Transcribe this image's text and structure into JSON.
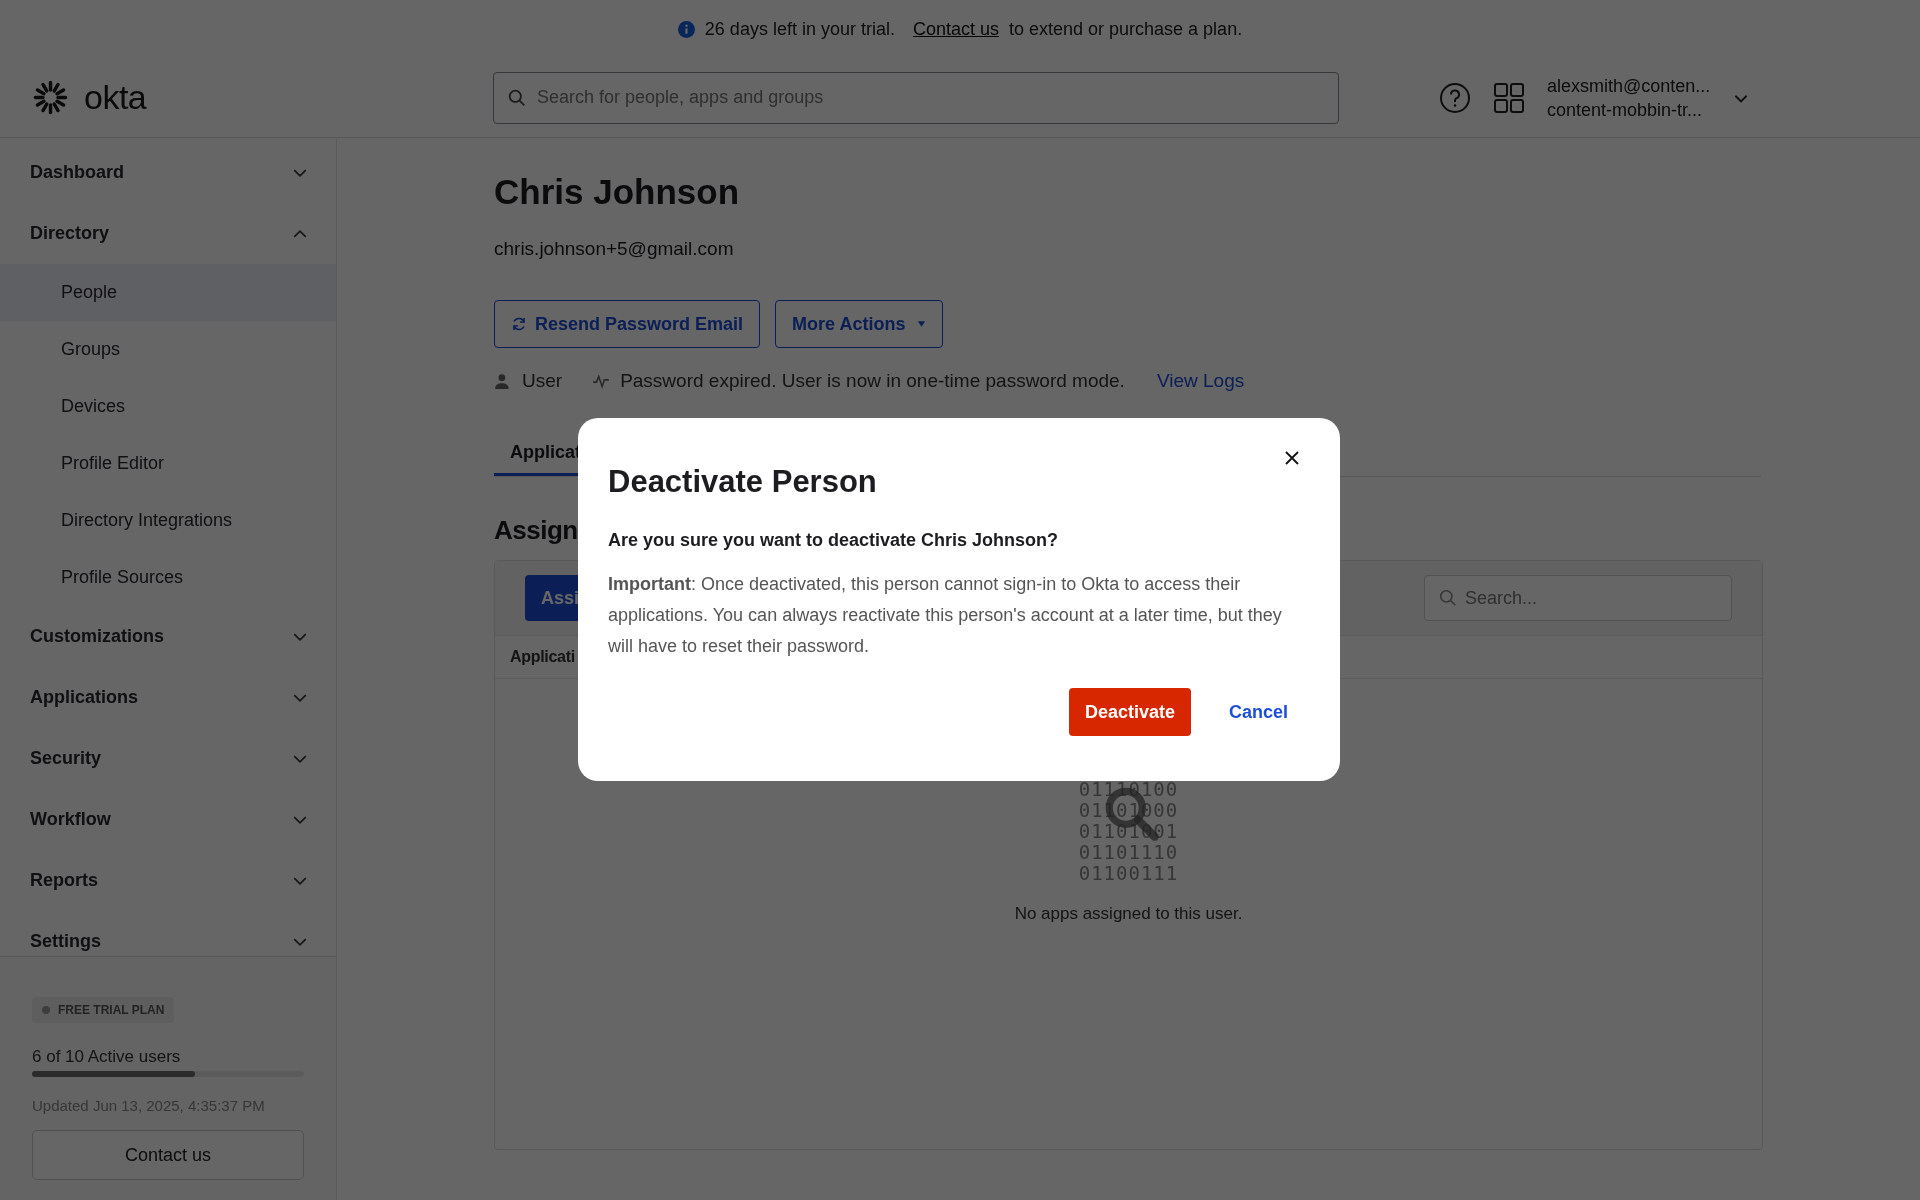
{
  "banner": {
    "text": "26 days left in your trial.",
    "link": "Contact us",
    "suffix": "to extend or purchase a plan."
  },
  "header": {
    "logo": "okta",
    "search": {
      "placeholder": "Search for people, apps and groups"
    },
    "account": {
      "email": "alexsmith@conten...",
      "org": "content-mobbin-tr..."
    }
  },
  "sidebar": {
    "items": [
      {
        "label": "Dashboard",
        "expanded": false
      },
      {
        "label": "Directory",
        "expanded": true,
        "children": [
          {
            "label": "People",
            "selected": true
          },
          {
            "label": "Groups",
            "selected": false
          },
          {
            "label": "Devices",
            "selected": false
          },
          {
            "label": "Profile Editor",
            "selected": false
          },
          {
            "label": "Directory Integrations",
            "selected": false
          },
          {
            "label": "Profile Sources",
            "selected": false
          }
        ]
      },
      {
        "label": "Customizations",
        "expanded": false
      },
      {
        "label": "Applications",
        "expanded": false
      },
      {
        "label": "Security",
        "expanded": false
      },
      {
        "label": "Workflow",
        "expanded": false
      },
      {
        "label": "Reports",
        "expanded": false
      },
      {
        "label": "Settings",
        "expanded": false
      }
    ],
    "plan": {
      "badge": "FREE TRIAL PLAN",
      "usage": "6 of 10 Active users",
      "level": 0.6,
      "updated": "Updated Jun 13, 2025, 4:35:37 PM",
      "button": "Contact us"
    }
  },
  "person": {
    "name": "Chris Johnson",
    "email": "chris.johnson+5@gmail.com",
    "buttons": [
      {
        "label": "Resend Password Email",
        "kind": "refresh"
      },
      {
        "label": "More Actions",
        "kind": "dropdown"
      }
    ],
    "role": "User",
    "status": "Password expired. User is now in one-time password mode.",
    "logs_link": "View Logs"
  },
  "tabs": [
    {
      "label": "Applicat",
      "selected": true
    }
  ],
  "section": {
    "title": "Assign",
    "assign_button": "Assi",
    "search": {
      "placeholder": "Search..."
    },
    "column_1": "Applicati",
    "empty": {
      "binary": [
        "01110100",
        "01101000",
        "01101001",
        "01101110",
        "01100111"
      ],
      "message": "No apps assigned to this user."
    }
  },
  "modal": {
    "title": "Deactivate Person",
    "question": "Are you sure you want to deactivate Chris Johnson?",
    "body": "**Important**: Once deactivated, this person cannot sign-in to Okta to access their applications. You can always reactivate this person's account at a later time, but they will have to reset their password.",
    "confirm": "Deactivate",
    "cancel": "Cancel"
  }
}
